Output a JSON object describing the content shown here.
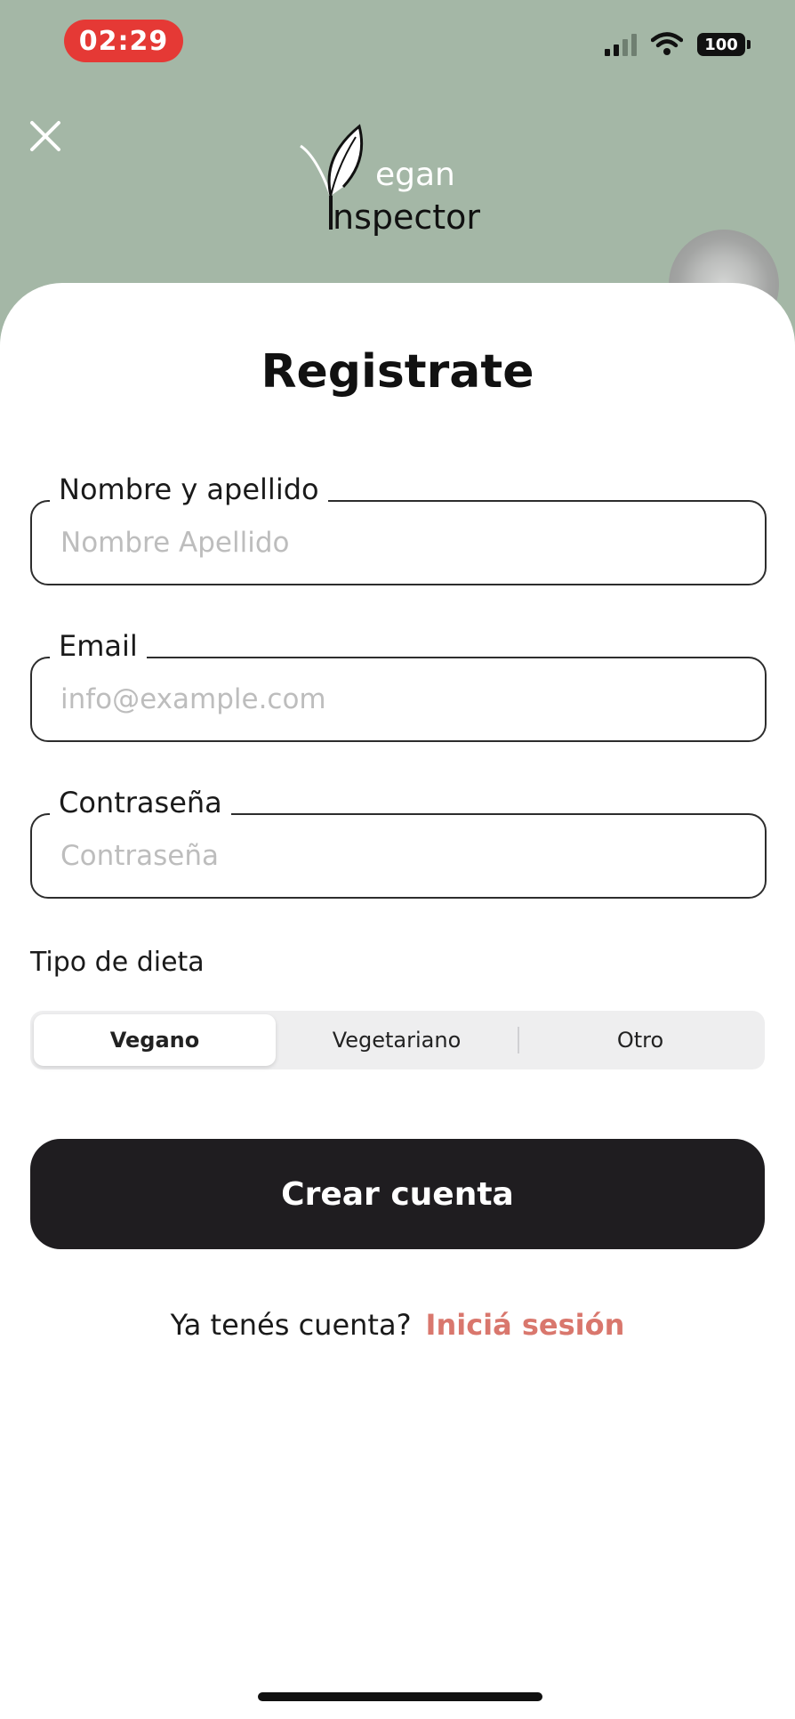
{
  "status_bar": {
    "time": "02:29",
    "battery": "100"
  },
  "header": {
    "logo_line1": "egan",
    "logo_line2": "nspector",
    "close_icon": "close-icon"
  },
  "form": {
    "title": "Registrate",
    "fields": [
      {
        "label": "Nombre y apellido",
        "placeholder": "Nombre Apellido"
      },
      {
        "label": "Email",
        "placeholder": "info@example.com"
      },
      {
        "label": "Contraseña",
        "placeholder": "Contraseña"
      }
    ],
    "diet_label": "Tipo de dieta",
    "diet_options": [
      "Vegano",
      "Vegetariano",
      "Otro"
    ],
    "diet_selected": "Vegano",
    "submit_label": "Crear cuenta",
    "login_prompt": "Ya tenés cuenta?",
    "login_link": "Iniciá sesión"
  },
  "colors": {
    "header_bg": "#a4b7a6",
    "time_pill": "#e53935",
    "button_bg": "#1f1d20",
    "link": "#d9776d"
  }
}
